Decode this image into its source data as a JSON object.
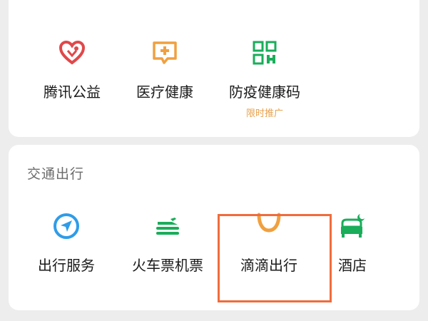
{
  "services": {
    "items": [
      {
        "label": "腾讯公益",
        "icon": "heart-charity-icon"
      },
      {
        "label": "医疗健康",
        "icon": "medical-chat-icon"
      },
      {
        "label": "防疫健康码",
        "icon": "health-qr-code-icon",
        "sub": "限时推广"
      }
    ]
  },
  "transport": {
    "title": "交通出行",
    "items": [
      {
        "label": "出行服务",
        "icon": "navigation-compass-icon"
      },
      {
        "label": "火车票机票",
        "icon": "train-plane-icon"
      },
      {
        "label": "滴滴出行",
        "icon": "didi-logo-icon"
      },
      {
        "label": "酒店",
        "icon": "hotel-bed-icon"
      }
    ]
  },
  "colors": {
    "charity_red": "#e0484a",
    "medical_orange": "#f0a040",
    "qr_green": "#1aad5a",
    "nav_blue": "#2f9ce8",
    "train_green": "#1aad5a",
    "didi_orange": "#f0a040",
    "hotel_green": "#1aad5a",
    "promo_text": "#e8a14c",
    "highlight": "#ef6c3c"
  }
}
